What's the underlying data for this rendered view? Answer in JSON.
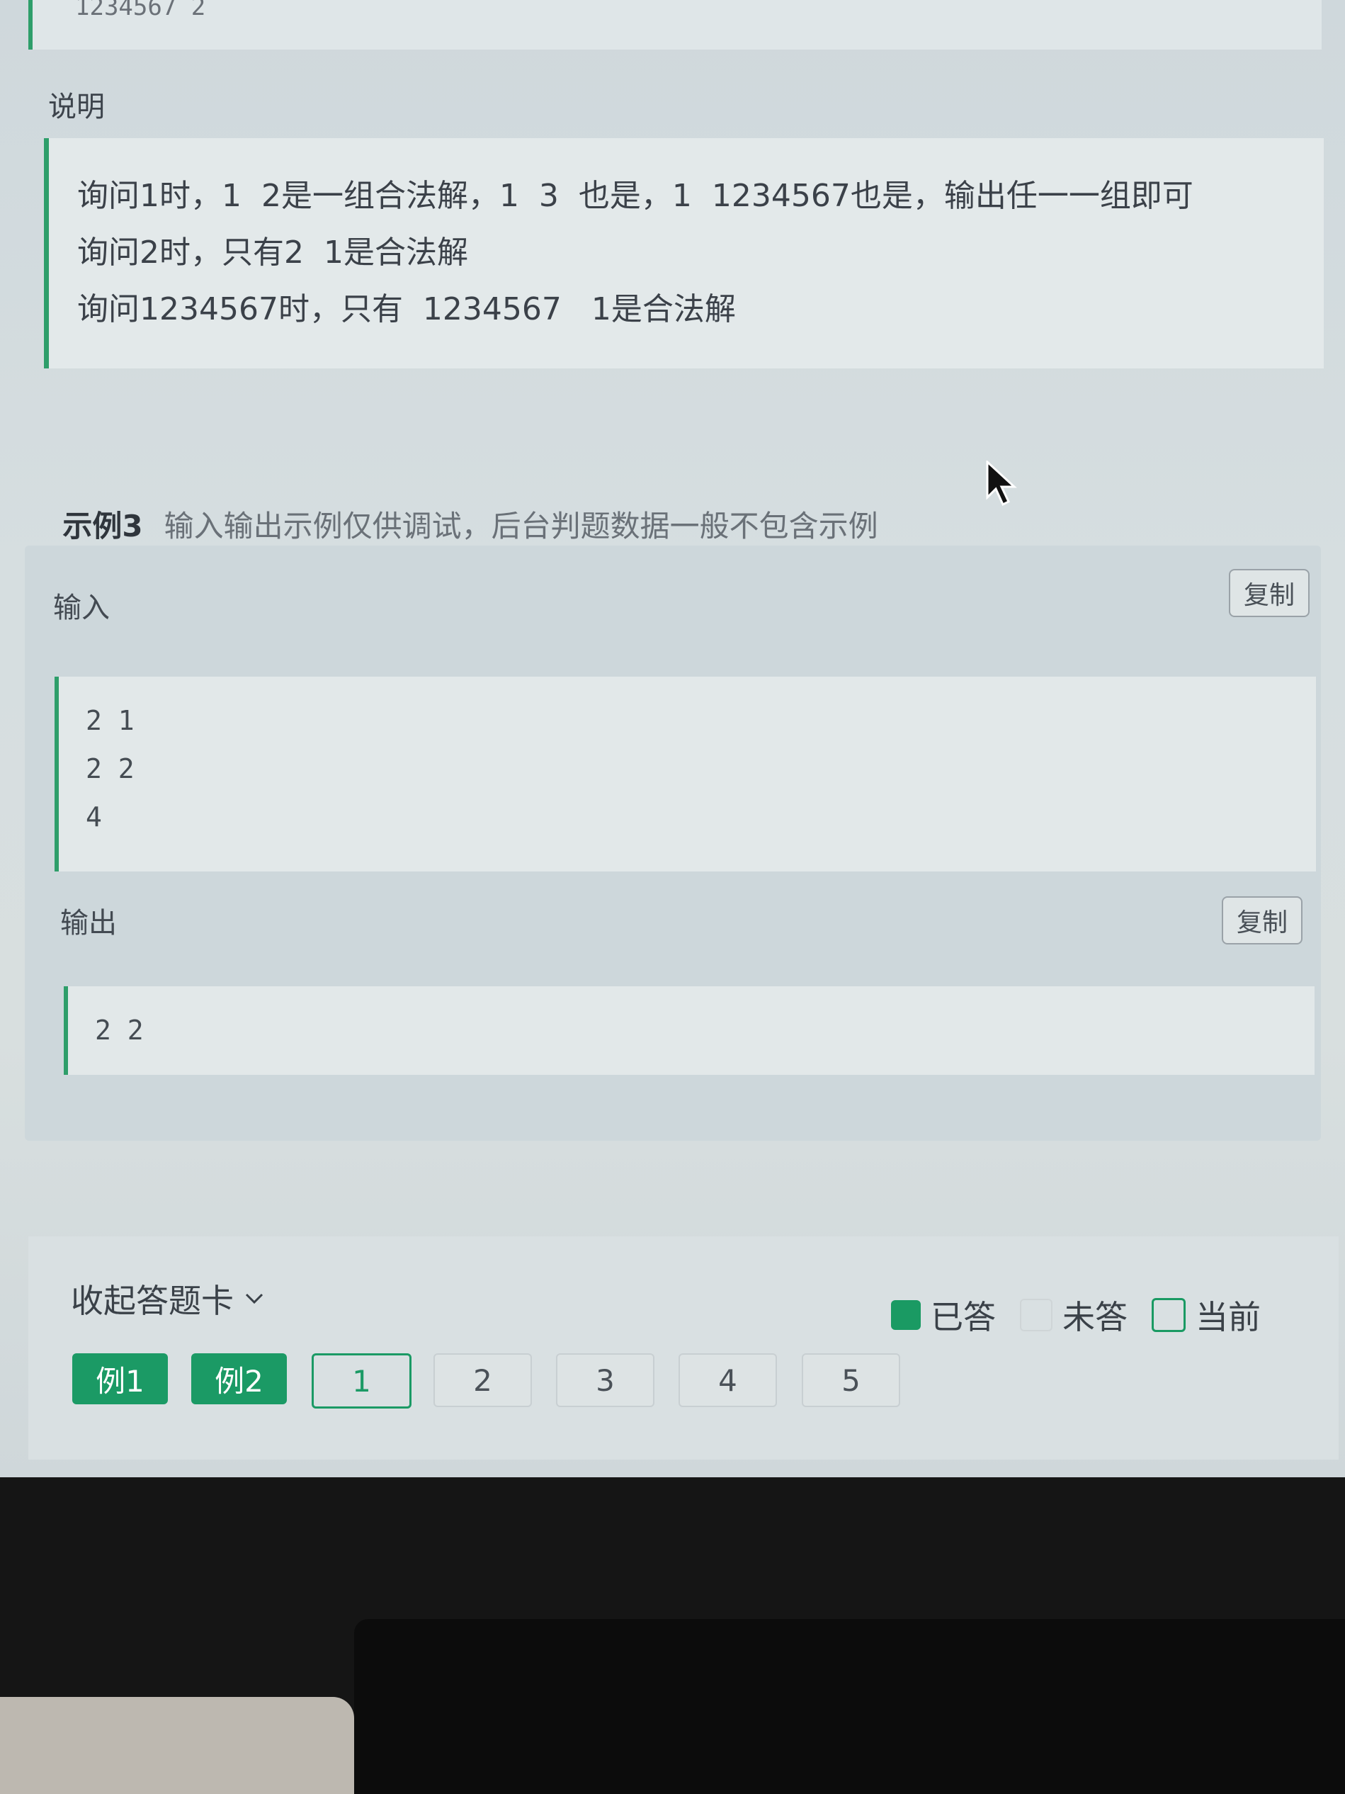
{
  "prev_block": {
    "text": "1234567 2"
  },
  "explanation": {
    "label": "说明",
    "lines": [
      "询问1时，1  2是一组合法解，1  3  也是，1  1234567也是，输出任一一组即可",
      "询问2时，只有2  1是合法解",
      "询问1234567时，只有  1234567   1是合法解"
    ]
  },
  "example3": {
    "title": "示例3",
    "hint": "输入输出示例仅供调试，后台判题数据一般不包含示例",
    "input_label": "输入",
    "output_label": "输出",
    "copy_label": "复制",
    "input_lines": [
      "2 1",
      "2 2",
      "4"
    ],
    "output_lines": [
      "2 2"
    ]
  },
  "answer_card": {
    "collapse_label": "收起答题卡",
    "legend": {
      "answered": "已答",
      "unanswered": "未答",
      "current": "当前"
    },
    "buttons": [
      "例1",
      "例2",
      "1",
      "2",
      "3",
      "4",
      "5"
    ]
  },
  "colors": {
    "accent": "#1b9a65",
    "code_border": "#2e9e6a"
  },
  "icons": {
    "collapse": "chevron-down-icon",
    "cursor": "mouse-pointer-icon"
  }
}
